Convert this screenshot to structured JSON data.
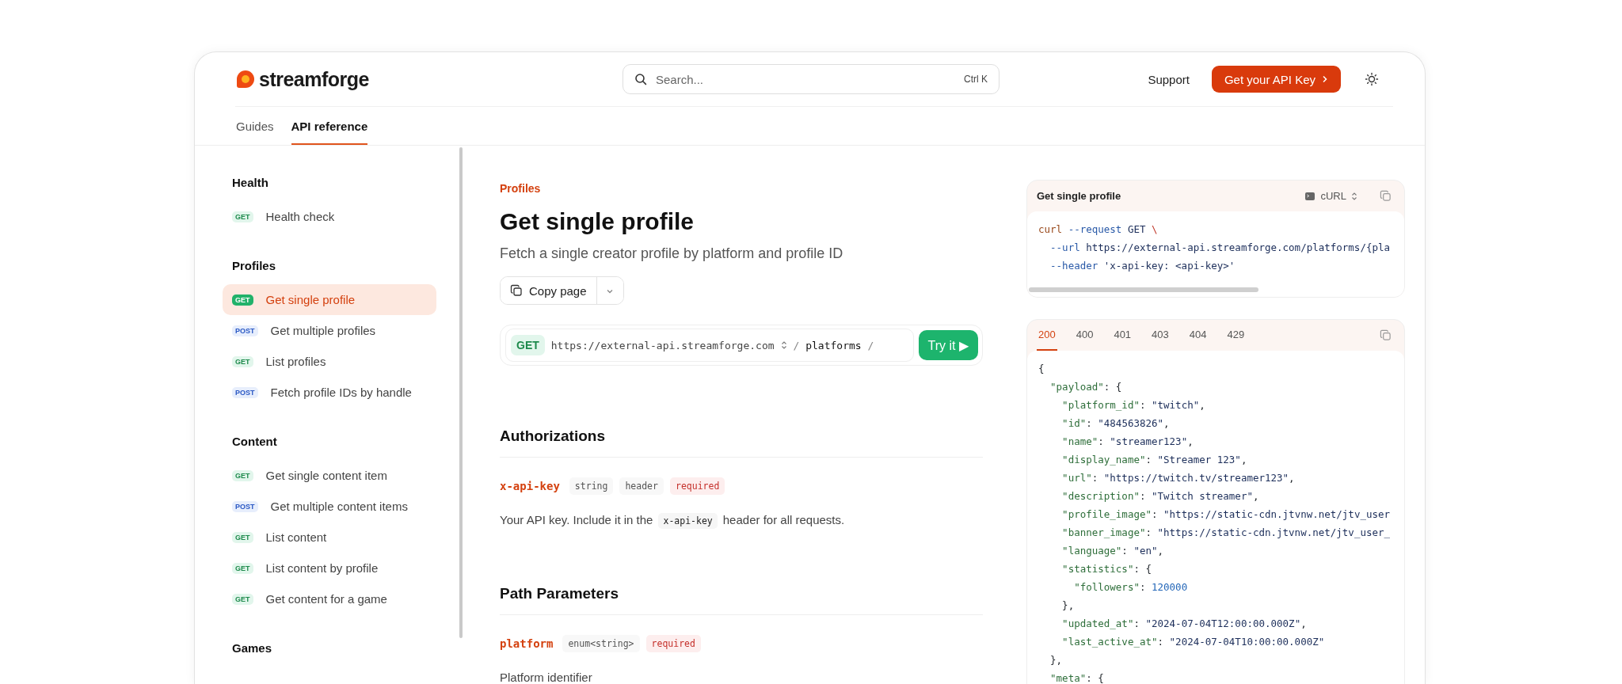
{
  "header": {
    "logo": "streamforge",
    "search": {
      "placeholder": "Search...",
      "shortcut": "Ctrl K"
    },
    "support_link": "Support",
    "cta_button": "Get your API Key"
  },
  "nav_tabs": [
    {
      "label": "Guides",
      "selected": false
    },
    {
      "label": "API reference",
      "selected": true
    }
  ],
  "sidebar": {
    "groups": [
      {
        "title": "Health",
        "items": [
          {
            "method": "GET",
            "kind": "get",
            "label": "Health check",
            "selected": false
          }
        ]
      },
      {
        "title": "Profiles",
        "items": [
          {
            "method": "GET",
            "kind": "get",
            "label": "Get single profile",
            "selected": true
          },
          {
            "method": "POST",
            "kind": "post",
            "label": "Get multiple profiles",
            "selected": false
          },
          {
            "method": "GET",
            "kind": "get",
            "label": "List profiles",
            "selected": false
          },
          {
            "method": "POST",
            "kind": "post",
            "label": "Fetch profile IDs by handle",
            "selected": false
          }
        ]
      },
      {
        "title": "Content",
        "items": [
          {
            "method": "GET",
            "kind": "get",
            "label": "Get single content item",
            "selected": false
          },
          {
            "method": "POST",
            "kind": "post",
            "label": "Get multiple content items",
            "selected": false
          },
          {
            "method": "GET",
            "kind": "get",
            "label": "List content",
            "selected": false
          },
          {
            "method": "GET",
            "kind": "get",
            "label": "List content by profile",
            "selected": false
          },
          {
            "method": "GET",
            "kind": "get",
            "label": "Get content for a game",
            "selected": false
          }
        ]
      },
      {
        "title": "Games"
      }
    ]
  },
  "page": {
    "breadcrumb": "Profiles",
    "title": "Get single profile",
    "description": "Fetch a single creator profile by platform and profile ID",
    "copy_button": "Copy page",
    "endpoint": {
      "method": "GET",
      "kind": "get",
      "base_url": "https://external-api.streamforge.com",
      "path": "/ **platforms** /",
      "try_button": "Try it ▶"
    },
    "sections": [
      {
        "title": "Authorizations",
        "params": [
          {
            "name": "x-api-key",
            "tags": [
              {
                "text": "string",
                "kind": "type"
              },
              {
                "text": "header",
                "kind": "type"
              },
              {
                "text": "required",
                "kind": "required"
              }
            ],
            "description": [
              {
                "text": "Your API key. Include it in the",
                "kind": "text"
              },
              {
                "text": "x-api-key",
                "kind": "code"
              },
              {
                "text": "header for all requests.",
                "kind": "text"
              }
            ]
          }
        ]
      },
      {
        "title": "Path Parameters",
        "params": [
          {
            "name": "platform",
            "tags": [
              {
                "text": "enum<string>",
                "kind": "type"
              },
              {
                "text": "required",
                "kind": "required"
              }
            ],
            "description": [
              {
                "text": "Platform identifier",
                "kind": "text"
              }
            ]
          }
        ]
      }
    ]
  },
  "request_panel": {
    "title": "Get single profile",
    "language": "cURL",
    "lines": [
      [
        {
          "text": "curl",
          "kind": "command"
        },
        {
          "text": " --request",
          "kind": "flag"
        },
        {
          "text": " GET",
          "kind": "value"
        },
        {
          "text": " \\",
          "kind": "escape"
        }
      ],
      [
        {
          "text": "  --url",
          "kind": "flag"
        },
        {
          "text": " https://external-api.streamforge.com/platforms/{pla",
          "kind": "value"
        }
      ],
      [
        {
          "text": "  --header",
          "kind": "flag"
        },
        {
          "text": " 'x-api-key: <api-key>'",
          "kind": "value"
        }
      ]
    ]
  },
  "response_panel": {
    "tabs": [
      {
        "label": "200",
        "selected": true
      },
      {
        "label": "400",
        "selected": false
      },
      {
        "label": "401",
        "selected": false
      },
      {
        "label": "403",
        "selected": false
      },
      {
        "label": "404",
        "selected": false
      },
      {
        "label": "429",
        "selected": false
      }
    ],
    "lines": [
      [
        {
          "text": "{",
          "kind": "punct"
        }
      ],
      [
        {
          "text": "  \"payload\"",
          "kind": "key"
        },
        {
          "text": ": {",
          "kind": "punct"
        }
      ],
      [
        {
          "text": "    \"platform_id\"",
          "kind": "key"
        },
        {
          "text": ": ",
          "kind": "punct"
        },
        {
          "text": "\"twitch\"",
          "kind": "string"
        },
        {
          "text": ",",
          "kind": "punct"
        }
      ],
      [
        {
          "text": "    \"id\"",
          "kind": "key"
        },
        {
          "text": ": ",
          "kind": "punct"
        },
        {
          "text": "\"484563826\"",
          "kind": "string"
        },
        {
          "text": ",",
          "kind": "punct"
        }
      ],
      [
        {
          "text": "    \"name\"",
          "kind": "key"
        },
        {
          "text": ": ",
          "kind": "punct"
        },
        {
          "text": "\"streamer123\"",
          "kind": "string"
        },
        {
          "text": ",",
          "kind": "punct"
        }
      ],
      [
        {
          "text": "    \"display_name\"",
          "kind": "key"
        },
        {
          "text": ": ",
          "kind": "punct"
        },
        {
          "text": "\"Streamer 123\"",
          "kind": "string"
        },
        {
          "text": ",",
          "kind": "punct"
        }
      ],
      [
        {
          "text": "    \"url\"",
          "kind": "key"
        },
        {
          "text": ": ",
          "kind": "punct"
        },
        {
          "text": "\"https://twitch.tv/streamer123\"",
          "kind": "string"
        },
        {
          "text": ",",
          "kind": "punct"
        }
      ],
      [
        {
          "text": "    \"description\"",
          "kind": "key"
        },
        {
          "text": ": ",
          "kind": "punct"
        },
        {
          "text": "\"Twitch streamer\"",
          "kind": "string"
        },
        {
          "text": ",",
          "kind": "punct"
        }
      ],
      [
        {
          "text": "    \"profile_image\"",
          "kind": "key"
        },
        {
          "text": ": ",
          "kind": "punct"
        },
        {
          "text": "\"https://static-cdn.jtvnw.net/jtv_user",
          "kind": "string"
        }
      ],
      [
        {
          "text": "    \"banner_image\"",
          "kind": "key"
        },
        {
          "text": ": ",
          "kind": "punct"
        },
        {
          "text": "\"https://static-cdn.jtvnw.net/jtv_user_",
          "kind": "string"
        }
      ],
      [
        {
          "text": "    \"language\"",
          "kind": "key"
        },
        {
          "text": ": ",
          "kind": "punct"
        },
        {
          "text": "\"en\"",
          "kind": "string"
        },
        {
          "text": ",",
          "kind": "punct"
        }
      ],
      [
        {
          "text": "    \"statistics\"",
          "kind": "key"
        },
        {
          "text": ": {",
          "kind": "punct"
        }
      ],
      [
        {
          "text": "      \"followers\"",
          "kind": "key"
        },
        {
          "text": ": ",
          "kind": "punct"
        },
        {
          "text": "120000",
          "kind": "number"
        }
      ],
      [
        {
          "text": "    },",
          "kind": "punct"
        }
      ],
      [
        {
          "text": "    \"updated_at\"",
          "kind": "key"
        },
        {
          "text": ": ",
          "kind": "punct"
        },
        {
          "text": "\"2024-07-04T12:00:00.000Z\"",
          "kind": "string"
        },
        {
          "text": ",",
          "kind": "punct"
        }
      ],
      [
        {
          "text": "    \"last_active_at\"",
          "kind": "key"
        },
        {
          "text": ": ",
          "kind": "punct"
        },
        {
          "text": "\"2024-07-04T10:00:00.000Z\"",
          "kind": "string"
        }
      ],
      [
        {
          "text": "  },",
          "kind": "punct"
        }
      ],
      [
        {
          "text": "  \"meta\"",
          "kind": "key"
        },
        {
          "text": ": {",
          "kind": "punct"
        }
      ]
    ]
  }
}
